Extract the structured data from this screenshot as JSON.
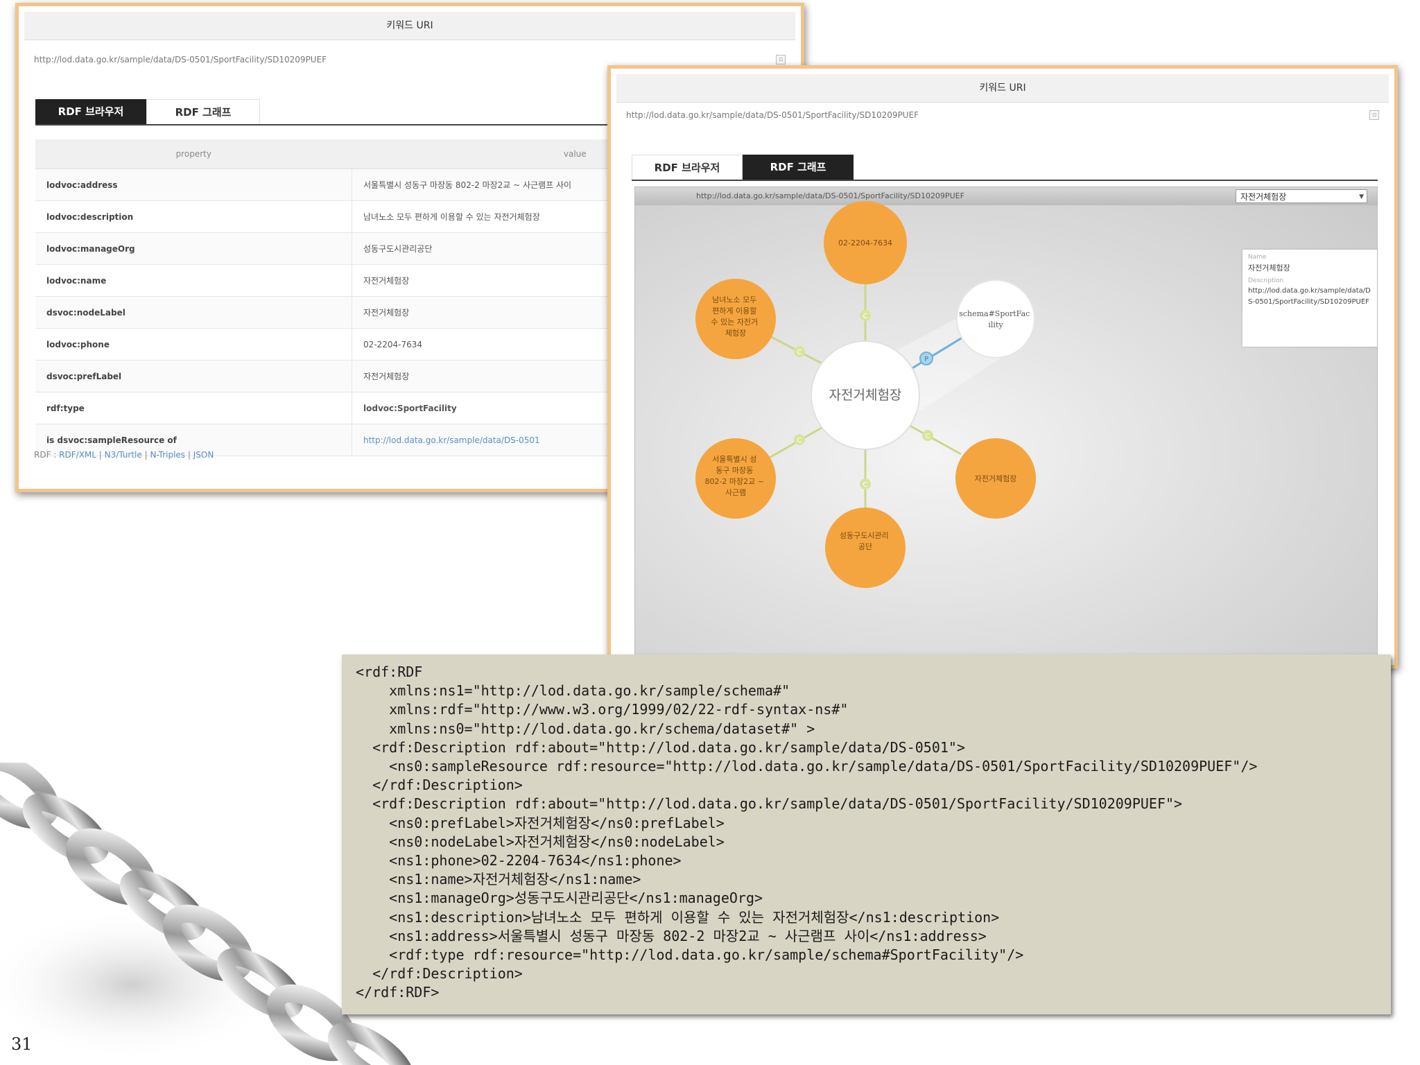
{
  "panel1": {
    "header": "키워드 URI",
    "uri": "http://lod.data.go.kr/sample/data/DS-0501/SportFacility/SD10209PUEF",
    "tabs": [
      "RDF 브라우저",
      "RDF 그래프"
    ],
    "table_headers": {
      "property": "property",
      "value": "value"
    },
    "rows": [
      {
        "property": "lodvoc:address",
        "value": "서울특별시 성동구 마장동 802-2 마장2교 ~ 사근램프 사이"
      },
      {
        "property": "lodvoc:description",
        "value": "남녀노소 모두 편하게 이용할 수 있는 자전거체험장"
      },
      {
        "property": "lodvoc:manageOrg",
        "value": "성동구도시관리공단"
      },
      {
        "property": "lodvoc:name",
        "value": "자전거체험장"
      },
      {
        "property": "dsvoc:nodeLabel",
        "value": "자전거체험장"
      },
      {
        "property": "lodvoc:phone",
        "value": "02-2204-7634"
      },
      {
        "property": "dsvoc:prefLabel",
        "value": "자전거체험장"
      },
      {
        "property": "rdf:type",
        "value": "lodvoc:SportFacility"
      },
      {
        "property": "is dsvoc:sampleResource of",
        "value": "http://lod.data.go.kr/sample/data/DS-0501"
      }
    ],
    "formats_prefix": "RDF :",
    "formats": [
      "RDF/XML",
      "N3/Turtle",
      "N-Triples",
      "JSON"
    ]
  },
  "panel2": {
    "header": "키워드 URI",
    "uri": "http://lod.data.go.kr/sample/data/DS-0501/SportFacility/SD10209PUEF",
    "tabs": [
      "RDF 브라우저",
      "RDF 그래프"
    ],
    "graph_url": "http://lod.data.go.kr/sample/data/DS-0501/SportFacility/SD10209PUEF",
    "select_value": "자전거체험장",
    "info": {
      "name_label": "Name",
      "name_value": "자전거체험장",
      "desc_label": "Description",
      "desc_value": "http://lod.data.go.kr/sample/data/DS-0501/SportFacility/SD10209PUEF"
    },
    "center_node": "자전거체험장",
    "nodes": {
      "top": "02-2204-7634",
      "upper_left": [
        "남녀노소 모두",
        "편하게 이용할",
        "수 있는 자전거",
        "체험장"
      ],
      "lower_left": [
        "서울특별시 성",
        "동구 마장동",
        "802-2 마장2교 ~",
        "사근램"
      ],
      "bottom": [
        "성동구도시관리",
        "공단"
      ],
      "lower_right": "자전거체험장",
      "schema": [
        "schema#SportFac",
        "ility"
      ]
    },
    "edge_labels": [
      "C",
      "C",
      "C",
      "C",
      "C",
      "P"
    ]
  },
  "code_lines": [
    "<rdf:RDF",
    "    xmlns:ns1=\"http://lod.data.go.kr/sample/schema#\"",
    "    xmlns:rdf=\"http://www.w3.org/1999/02/22-rdf-syntax-ns#\"",
    "    xmlns:ns0=\"http://lod.data.go.kr/schema/dataset#\" >",
    "  <rdf:Description rdf:about=\"http://lod.data.go.kr/sample/data/DS-0501\">",
    "    <ns0:sampleResource rdf:resource=\"http://lod.data.go.kr/sample/data/DS-0501/SportFacility/SD10209PUEF\"/>",
    "  </rdf:Description>",
    "  <rdf:Description rdf:about=\"http://lod.data.go.kr/sample/data/DS-0501/SportFacility/SD10209PUEF\">",
    "    <ns0:prefLabel>자전거체험장</ns0:prefLabel>",
    "    <ns0:nodeLabel>자전거체험장</ns0:nodeLabel>",
    "    <ns1:phone>02-2204-7634</ns1:phone>",
    "    <ns1:name>자전거체험장</ns1:name>",
    "    <ns1:manageOrg>성동구도시관리공단</ns1:manageOrg>",
    "    <ns1:description>남녀노소 모두 편하게 이용할 수 있는 자전거체험장</ns1:description>",
    "    <ns1:address>서울특별시 성동구 마장동 802-2 마장2교 ~ 사근램프 사이</ns1:address>",
    "    <rdf:type rdf:resource=\"http://lod.data.go.kr/sample/schema#SportFacility\"/>",
    "  </rdf:Description>",
    "</rdf:RDF>"
  ],
  "page_number": "31",
  "colors": {
    "panel_border": "#f3c48a",
    "node_orange": "#f5a53f",
    "code_bg": "#d9d5c4",
    "edge": "#c9d88a"
  }
}
